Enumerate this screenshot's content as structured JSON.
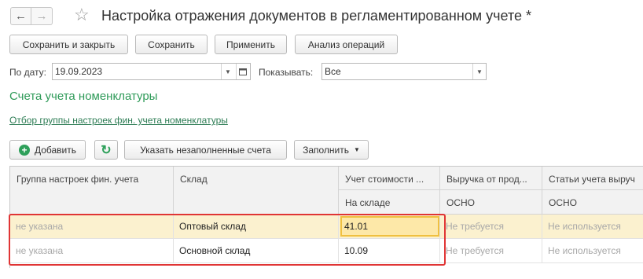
{
  "title": "Настройка отражения документов в регламентированном учете *",
  "toolbar": {
    "save_close": "Сохранить и закрыть",
    "save": "Сохранить",
    "apply": "Применить",
    "analysis": "Анализ операций"
  },
  "filter": {
    "date_label": "По дату:",
    "date_value": "19.09.2023",
    "show_label": "Показывать:",
    "show_value": "Все"
  },
  "section_title": "Счета учета номенклатуры",
  "filter_link": "Отбор группы настроек фин. учета номенклатуры",
  "table_toolbar": {
    "add": "Добавить",
    "fill_empty": "Указать незаполненные счета",
    "fill": "Заполнить"
  },
  "table": {
    "headers": [
      "Группа настроек фин. учета",
      "Склад",
      "Учет стоимости ...",
      "Выручка от прод...",
      "Статьи учета выруч"
    ],
    "subheaders": [
      "На складе",
      "ОСНО",
      "ОСНО"
    ],
    "rows": [
      {
        "group": "не указана",
        "warehouse": "Оптовый склад",
        "cost": "41.01",
        "revenue": "Не требуется",
        "items": "Не используется"
      },
      {
        "group": "не указана",
        "warehouse": "Основной склад",
        "cost": "10.09",
        "revenue": "Не требуется",
        "items": "Не используется"
      }
    ]
  },
  "colors": {
    "section_green": "#2e9a58",
    "selected_row": "#fbf1cf",
    "highlight_red": "#e03535"
  }
}
